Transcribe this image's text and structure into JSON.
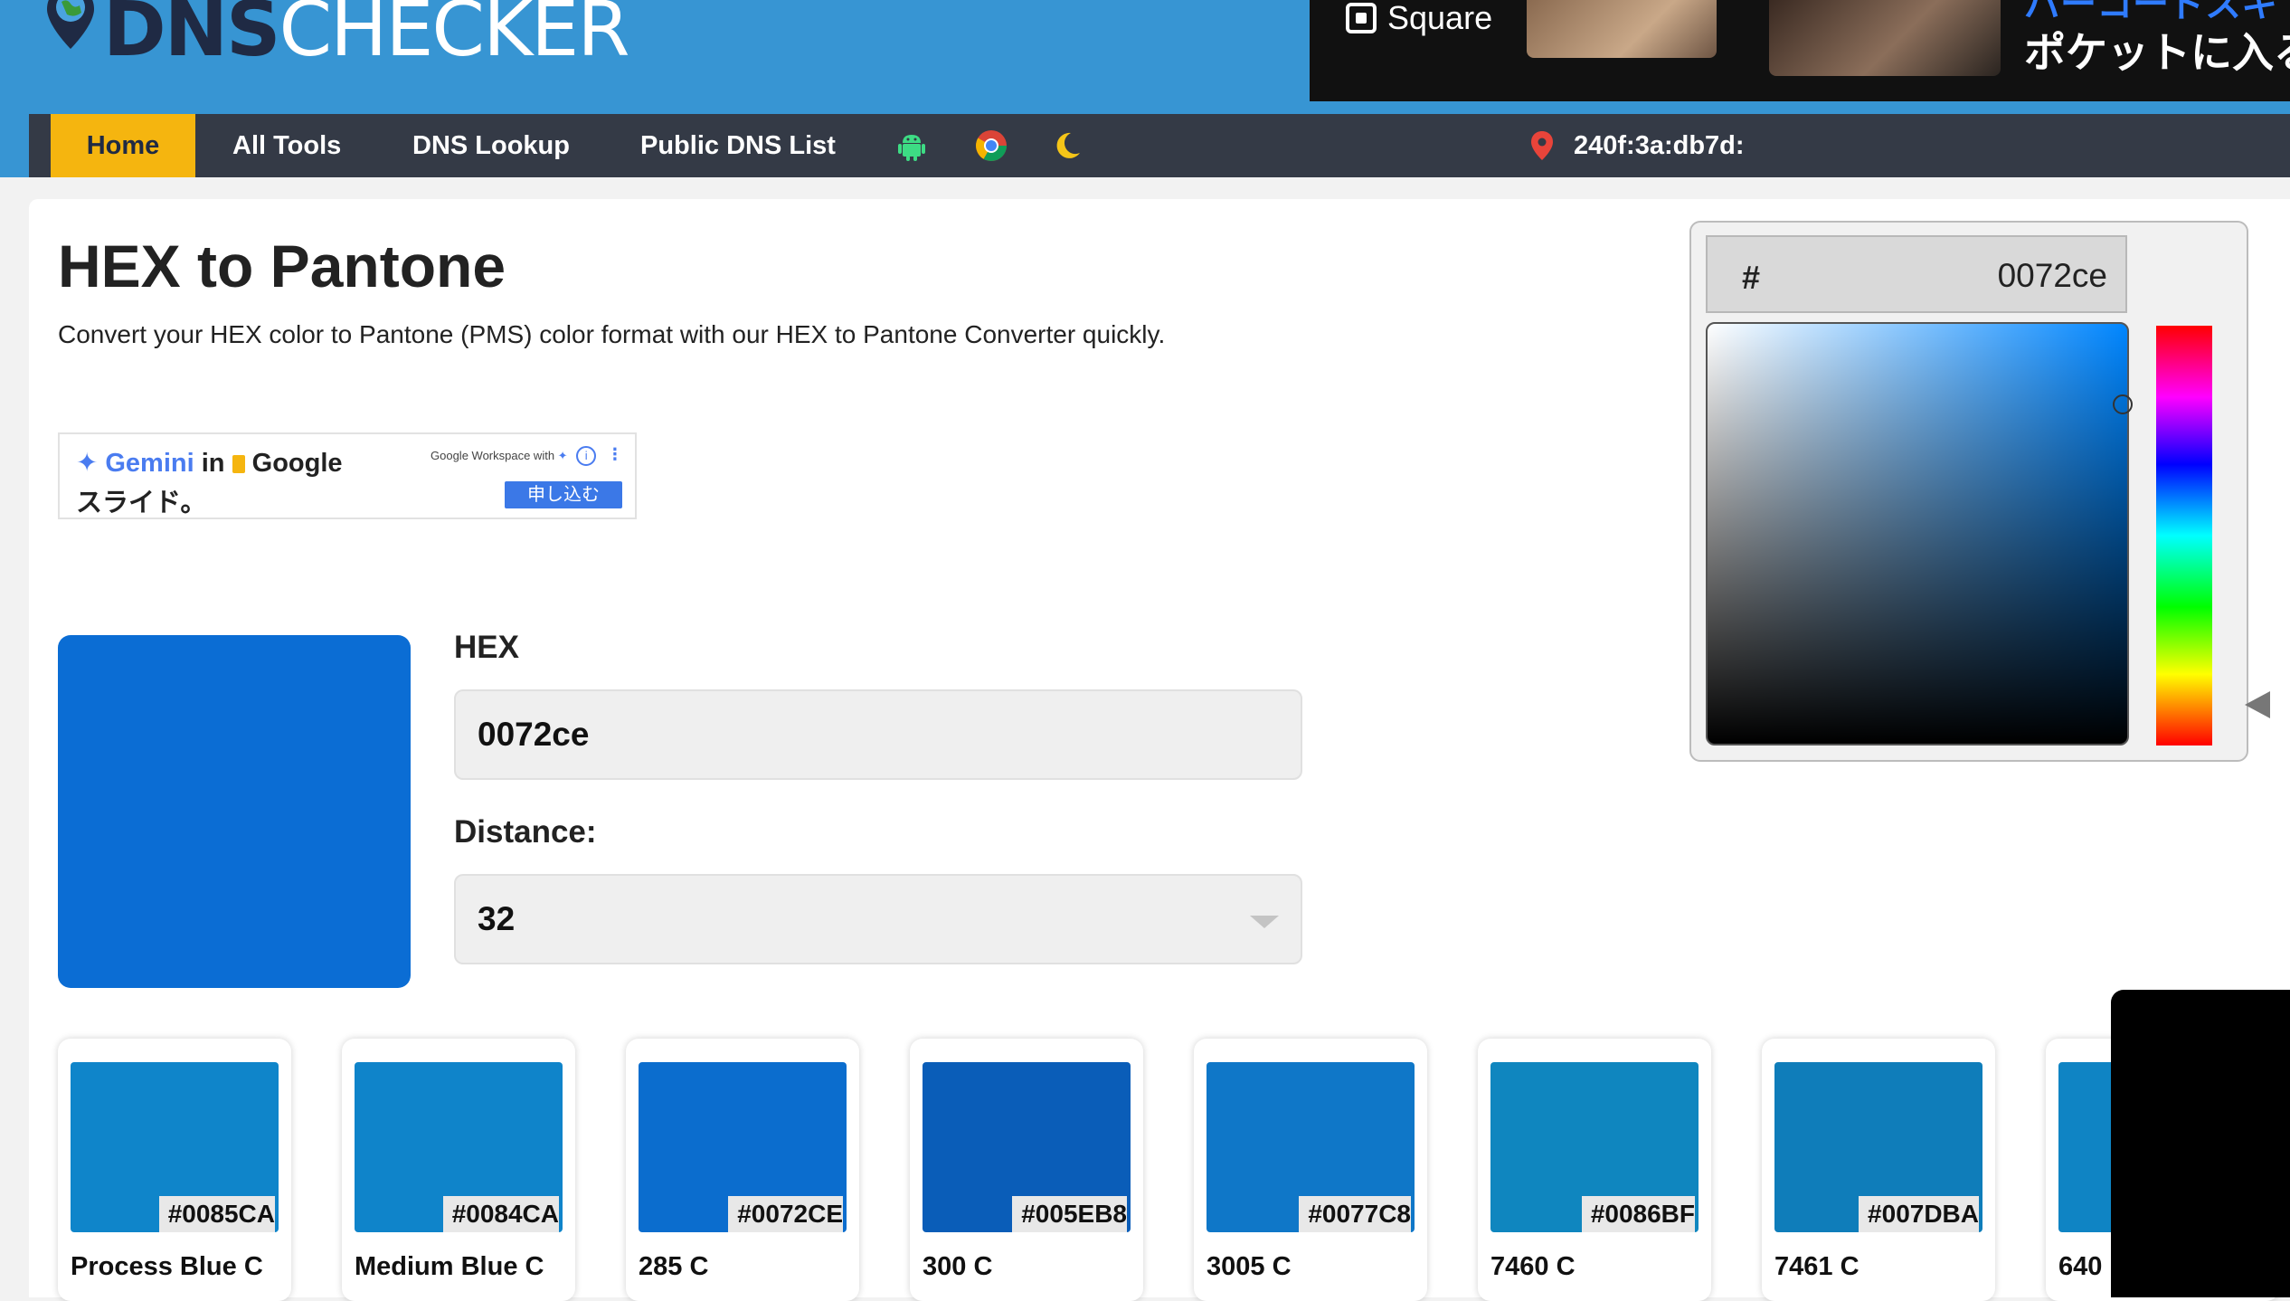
{
  "header": {
    "logo": {
      "dns": "DNS",
      "checker": "CHECKER",
      "icon": "globe-pin-icon"
    },
    "ad": {
      "brand": "Square",
      "jp_top": "バーコードスキ",
      "jp_main": "ポケットに入る"
    }
  },
  "nav": {
    "items": [
      {
        "label": "Home",
        "active": true
      },
      {
        "label": "All Tools"
      },
      {
        "label": "DNS Lookup"
      },
      {
        "label": "Public DNS List"
      }
    ],
    "icons": [
      "android-icon",
      "chrome-icon",
      "moon-icon"
    ],
    "ip": "240f:3a:db7d:"
  },
  "page": {
    "title": "HEX to Pantone",
    "subtitle": "Convert your HEX color to Pantone (PMS) color format with our HEX to Pantone Converter quickly."
  },
  "mid_ad": {
    "gemini": "Gemini",
    "in": "in",
    "google": "Google",
    "jp": "スライド。",
    "workspace": "Google Workspace with",
    "button": "申し込む"
  },
  "form": {
    "hex_label": "HEX",
    "hex_value": "0072ce",
    "distance_label": "Distance:",
    "distance_value": "32",
    "swatch_color": "#0b6dd4"
  },
  "picker": {
    "hash": "#",
    "value": "0072ce"
  },
  "results": [
    {
      "hex": "#0085CA",
      "name": "Process Blue C",
      "color": "#0f85ca"
    },
    {
      "hex": "#0084CA",
      "name": "Medium Blue C",
      "color": "#0f84ca"
    },
    {
      "hex": "#0072CE",
      "name": "285 C",
      "color": "#0b6dce"
    },
    {
      "hex": "#005EB8",
      "name": "300 C",
      "color": "#0a5db8"
    },
    {
      "hex": "#0077C8",
      "name": "3005 C",
      "color": "#0f77c8"
    },
    {
      "hex": "#0086BF",
      "name": "7460 C",
      "color": "#0f86bf"
    },
    {
      "hex": "#007DBA",
      "name": "7461 C",
      "color": "#0f7dba"
    },
    {
      "hex": "",
      "name": "640",
      "color": "#0f84c4"
    }
  ]
}
